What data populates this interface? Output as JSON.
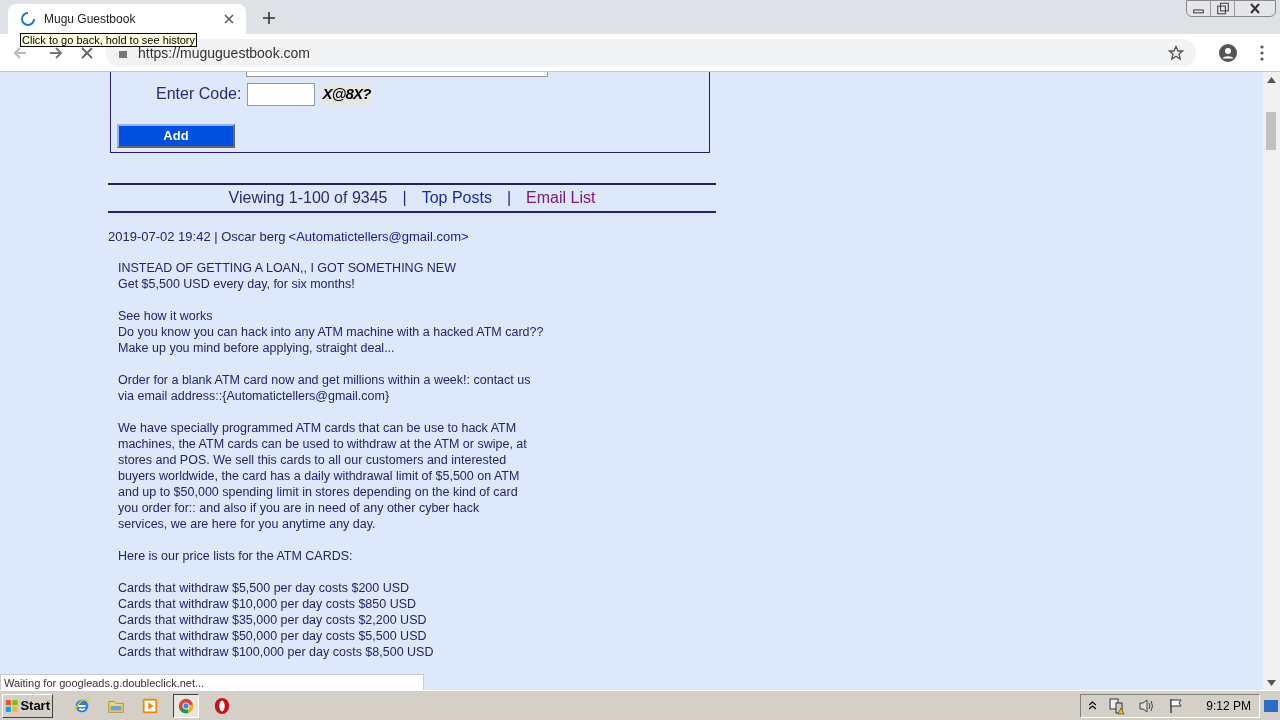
{
  "browser": {
    "tab": {
      "title": "Mugu Guestbook",
      "loading": true
    },
    "tooltip": "Click to go back, hold to see history",
    "url": "https://muguguestbook.com"
  },
  "form": {
    "code_label": "Enter Code:",
    "captcha": "X@8X?",
    "submit": "Add"
  },
  "nav": {
    "viewing": "Viewing 1-100 of 9345",
    "separators": [
      "|",
      "|"
    ],
    "links": [
      {
        "label": "Top Posts",
        "visited": false
      },
      {
        "label": "Email List",
        "visited": true
      }
    ]
  },
  "post": {
    "date": "2019-07-02 19:42 | Oscar berg",
    "email": "<Automatictellers@gmail.com>",
    "paragraphs": [
      [
        "INSTEAD OF GETTING A LOAN,, I GOT SOMETHING NEW",
        "Get $5,500 USD every day, for six months!"
      ],
      [
        "See how it works",
        "Do you know you can hack into any ATM machine with a hacked ATM card??",
        "Make up you mind before applying, straight deal..."
      ],
      [
        "Order for a blank ATM card now and get millions within a week!: contact us",
        "via email address::{Automatictellers@gmail.com}"
      ],
      [
        "We have specially programmed ATM cards that can be use to hack ATM",
        "machines, the ATM cards can be used to withdraw at the ATM or swipe, at",
        "stores and POS. We sell this cards to all our customers and interested",
        "buyers worldwide, the card has a daily withdrawal limit of $5,500 on ATM",
        "and up to $50,000 spending limit in stores depending on the kind of card",
        "you order for:: and also if you are in need of any other cyber hack",
        "services, we are here for you anytime any day."
      ],
      [
        "Here is our price lists for the ATM CARDS:"
      ],
      [
        "Cards that withdraw $5,500 per day costs $200 USD",
        "Cards that withdraw $10,000 per day costs $850 USD",
        "Cards that withdraw $35,000 per day costs $2,200 USD",
        "Cards that withdraw $50,000 per day costs $5,500 USD",
        "Cards that withdraw $100,000 per day costs $8,500 USD"
      ]
    ]
  },
  "status_bar": "Waiting for googleads.g.doubleclick.net...",
  "taskbar": {
    "start": "Start",
    "apps": [
      {
        "kind": "ie",
        "active": false
      },
      {
        "kind": "folder",
        "active": false
      },
      {
        "kind": "media",
        "active": false
      },
      {
        "kind": "chrome",
        "active": true
      },
      {
        "kind": "opera",
        "active": false
      }
    ],
    "clock": "9:12 PM"
  }
}
